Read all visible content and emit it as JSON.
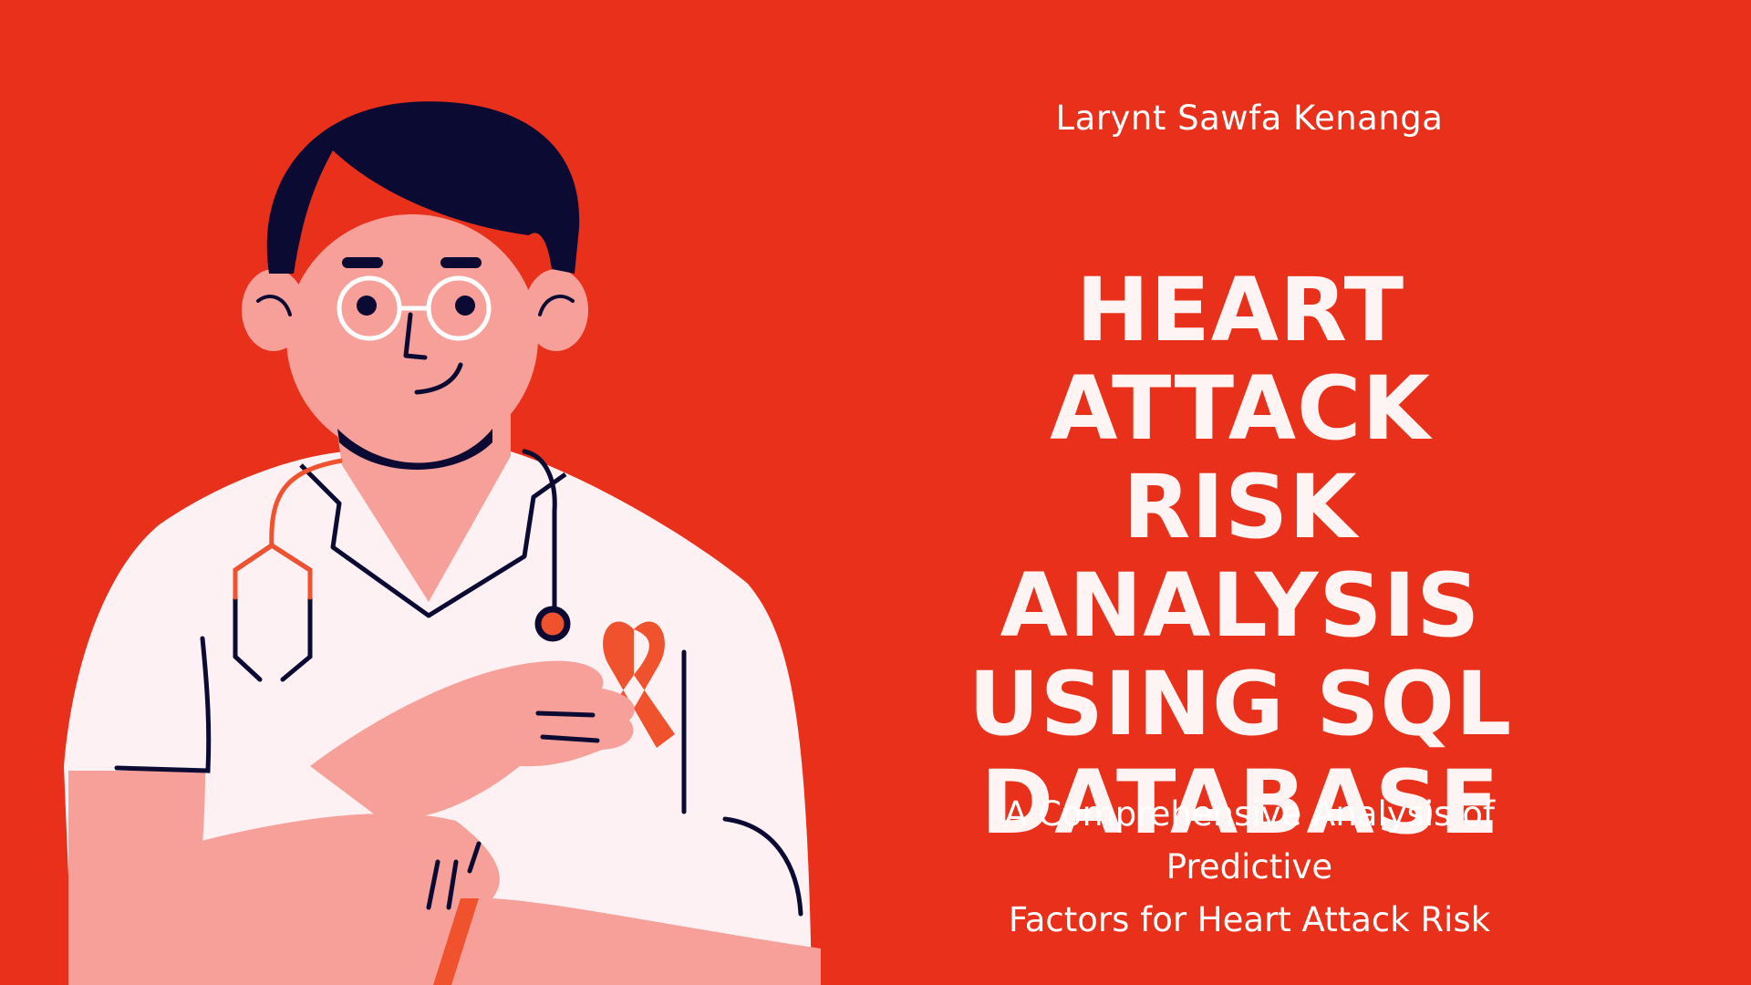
{
  "slide": {
    "author": "Larynt Sawfa Kenanga",
    "title": "HEART ATTACK\nRISK ANALYSIS\nUSING SQL\nDATABASE",
    "subtitle": "A Comprehensive Analysis of Predictive\nFactors for Heart Attack Risk",
    "illustration_icon": "doctor-with-awareness-ribbon-illustration"
  },
  "colors": {
    "background": "#e8301a",
    "skin": "#f7a09a",
    "hair": "#0a0a33",
    "coat": "#fdf1f3",
    "ribbon": "#f0522e",
    "title_text": "#fff4f4"
  }
}
